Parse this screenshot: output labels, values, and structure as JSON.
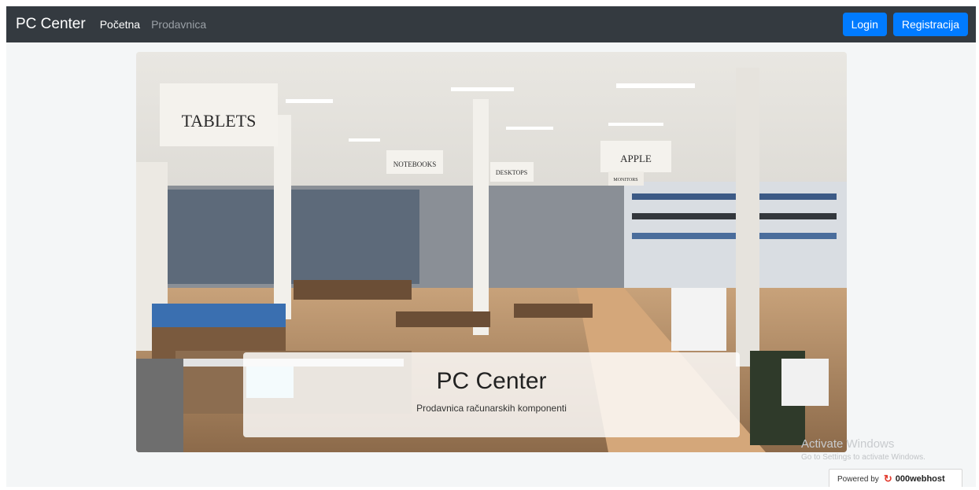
{
  "navbar": {
    "brand": "PC Center",
    "links": [
      {
        "label": "Početna"
      },
      {
        "label": "Prodavnica"
      }
    ],
    "buttons": {
      "login": "Login",
      "register": "Registracija"
    }
  },
  "hero": {
    "signs": [
      "TABLETS",
      "NOTEBOOKS",
      "DESKTOPS",
      "APPLE",
      "MONITORS"
    ],
    "title": "PC Center",
    "subtitle": "Prodavnica računarskih komponenti"
  },
  "overlay": {
    "activate_title": "Activate Windows",
    "activate_sub": "Go to Settings to activate Windows."
  },
  "badge": {
    "prefix": "Powered by",
    "brand": "000webhost"
  },
  "colors": {
    "navbar": "#343a40",
    "button": "#007bff",
    "page_bg": "#f4f6f7"
  }
}
